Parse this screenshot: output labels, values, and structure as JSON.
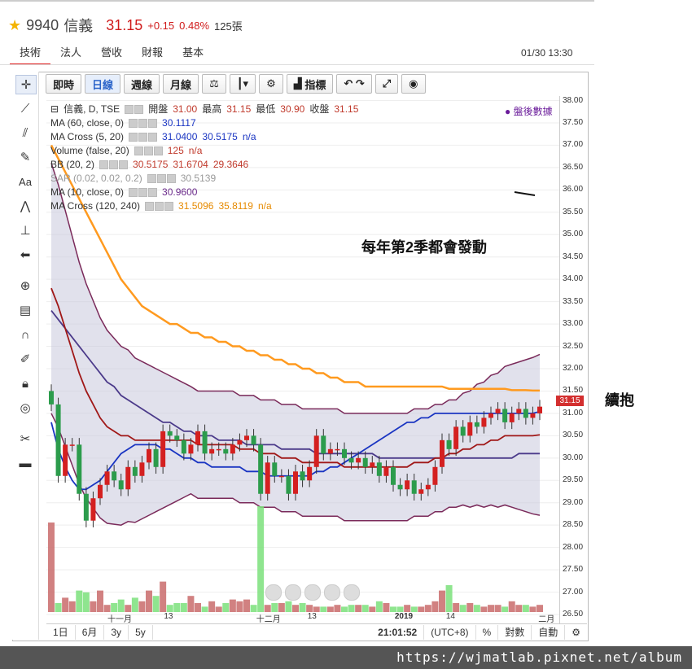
{
  "header": {
    "code": "9940",
    "name": "信義",
    "price": "31.15",
    "change": "+0.15",
    "percent": "0.48%",
    "volume": "125張"
  },
  "nav_tabs": [
    "技術",
    "法人",
    "營收",
    "財報",
    "基本"
  ],
  "datetime": "01/30 13:30",
  "toolbar": {
    "realtime": "即時",
    "daily": "日線",
    "weekly": "週線",
    "monthly": "月線",
    "indicators": "指標"
  },
  "legend": {
    "main": {
      "label": "信義, D, TSE",
      "open_label": "開盤",
      "open": "31.00",
      "high_label": "最高",
      "high": "31.15",
      "low_label": "最低",
      "low": "30.90",
      "close_label": "收盤",
      "close": "31.15"
    },
    "rows": [
      {
        "label": "MA (60, close, 0)",
        "values": [
          "30.1117"
        ],
        "color": "v-blue"
      },
      {
        "label": "MA Cross (5, 20)",
        "values": [
          "31.0400",
          "30.5175",
          "n/a"
        ],
        "color": "v-blue"
      },
      {
        "label": "Volume (false, 20)",
        "values": [
          "125",
          "n/a"
        ],
        "color": "v-red"
      },
      {
        "label": "BB (20, 2)",
        "values": [
          "30.5175",
          "31.6704",
          "29.3646"
        ],
        "color": "v-red"
      },
      {
        "label": "SAR (0.02, 0.02, 0.2)",
        "values": [
          "30.5139"
        ],
        "color": "v-gray"
      },
      {
        "label": "MA (10, close, 0)",
        "values": [
          "30.9600"
        ],
        "color": "v-purple"
      },
      {
        "label": "MA Cross (120, 240)",
        "values": [
          "31.5096",
          "35.8119",
          "n/a"
        ],
        "color": "v-orange"
      }
    ]
  },
  "after_hours": "盤後數據",
  "annotation": "每年第2季都會發動",
  "side_note": "續抱",
  "current_price_label": "31.15",
  "price_axis": [
    "38.00",
    "37.50",
    "37.00",
    "36.50",
    "36.00",
    "35.50",
    "35.00",
    "34.50",
    "34.00",
    "33.50",
    "33.00",
    "32.50",
    "32.00",
    "31.50",
    "31.00",
    "30.50",
    "30.00",
    "29.50",
    "29.00",
    "28.50",
    "28.00",
    "27.50",
    "27.00",
    "26.50"
  ],
  "date_axis": [
    {
      "label": "十一月",
      "pos": 0.135
    },
    {
      "label": "13",
      "pos": 0.245
    },
    {
      "label": "十二月",
      "pos": 0.425
    },
    {
      "label": "13",
      "pos": 0.525
    },
    {
      "label": "2019",
      "pos": 0.695
    },
    {
      "label": "14",
      "pos": 0.795
    },
    {
      "label": "二月",
      "pos": 0.975
    }
  ],
  "bottom_bar": {
    "ranges": [
      "1日",
      "6月",
      "3y",
      "5y"
    ],
    "clock": "21:01:52",
    "tz": "(UTC+8)",
    "pct": "%",
    "log": "對數",
    "auto": "自動"
  },
  "footer_url": "https://wjmatlab.pixnet.net/album",
  "chart_data": {
    "type": "candlestick",
    "ylim": [
      26.3,
      38.1
    ],
    "close": [
      31.2,
      29.6,
      30.3,
      30.3,
      29.2,
      28.6,
      29.1,
      29.4,
      29.7,
      29.5,
      29.3,
      29.8,
      29.6,
      29.9,
      30.2,
      29.8,
      30.6,
      30.5,
      30.4,
      30.1,
      30.3,
      30.6,
      30.1,
      30.2,
      30.2,
      30.1,
      30.3,
      30.4,
      30.5,
      30.3,
      29.2,
      29.9,
      29.6,
      29.6,
      29.2,
      29.7,
      29.5,
      29.8,
      30.5,
      30.1,
      30.2,
      30.2,
      30.0,
      29.9,
      30.0,
      29.8,
      29.9,
      29.6,
      29.8,
      29.4,
      29.3,
      29.5,
      29.2,
      29.3,
      29.4,
      29.8,
      30.4,
      30.2,
      30.7,
      30.5,
      30.8,
      30.7,
      30.9,
      31.0,
      31.1,
      30.8,
      31.0,
      31.1,
      30.9,
      31.0,
      31.15
    ],
    "volume": [
      500,
      50,
      80,
      60,
      120,
      110,
      60,
      120,
      40,
      50,
      70,
      40,
      80,
      60,
      120,
      90,
      170,
      40,
      50,
      50,
      90,
      50,
      30,
      60,
      30,
      50,
      70,
      60,
      70,
      40,
      600,
      40,
      50,
      50,
      60,
      40,
      50,
      40,
      30,
      30,
      30,
      40,
      30,
      40,
      40,
      40,
      30,
      60,
      50,
      30,
      30,
      40,
      30,
      30,
      40,
      60,
      120,
      150,
      50,
      40,
      50,
      40,
      30,
      40,
      40,
      30,
      60,
      40,
      40,
      30,
      40
    ],
    "series": [
      {
        "name": "MA (60, close, 0)",
        "values": [
          33.3,
          33.1,
          32.9,
          32.7,
          32.5,
          32.3,
          32.1,
          31.9,
          31.7,
          31.6,
          31.4,
          31.3,
          31.2,
          31.1,
          31.0,
          30.9,
          30.8,
          30.8,
          30.7,
          30.6,
          30.6,
          30.5,
          30.5,
          30.5,
          30.4,
          30.4,
          30.4,
          30.4,
          30.3,
          30.3,
          30.3,
          30.3,
          30.3,
          30.2,
          30.2,
          30.2,
          30.2,
          30.2,
          30.1,
          30.1,
          30.1,
          30.1,
          30.1,
          30.1,
          30.1,
          30.1,
          30.1,
          30.0,
          30.0,
          30.0,
          30.0,
          30.0,
          30.0,
          30.0,
          30.0,
          30.0,
          30.0,
          30.0,
          30.0,
          30.0,
          30.0,
          30.0,
          30.0,
          30.0,
          30.0,
          30.0,
          30.0,
          30.1,
          30.1,
          30.1,
          30.1
        ]
      },
      {
        "name": "MA Cross (5, 20)",
        "values": [
          30.8,
          30.2,
          29.8,
          29.5,
          29.3,
          29.3,
          29.4,
          29.5,
          29.7,
          29.9,
          30.1,
          30.2,
          30.3,
          30.3,
          30.3,
          30.3,
          30.2,
          30.2,
          30.1,
          30.0,
          30.0,
          29.9,
          29.9,
          29.8,
          29.8,
          29.8,
          29.8,
          29.8,
          29.7,
          29.7,
          29.7,
          29.6,
          29.6,
          29.6,
          29.6,
          29.6,
          29.6,
          29.6,
          29.7,
          29.7,
          29.8,
          29.8,
          29.9,
          30.0,
          30.1,
          30.2,
          30.3,
          30.4,
          30.5,
          30.6,
          30.7,
          30.8,
          30.8,
          30.9,
          30.9,
          31.0,
          31.0,
          31.0,
          31.0,
          31.0,
          31.0,
          31.0,
          31.0,
          31.0,
          31.0,
          31.0,
          31.0,
          31.0,
          31.0,
          31.0,
          31.04
        ]
      },
      {
        "name": "BB (20, 2)",
        "values": [
          33.8,
          33.4,
          32.9,
          32.4,
          31.9,
          31.5,
          31.2,
          30.9,
          30.7,
          30.6,
          30.5,
          30.5,
          30.4,
          30.4,
          30.4,
          30.4,
          30.4,
          30.4,
          30.4,
          30.4,
          30.4,
          30.3,
          30.3,
          30.3,
          30.3,
          30.3,
          30.3,
          30.2,
          30.2,
          30.2,
          30.1,
          30.1,
          30.1,
          30.0,
          30.0,
          30.0,
          29.9,
          29.9,
          29.9,
          29.9,
          29.9,
          29.9,
          29.8,
          29.8,
          29.8,
          29.8,
          29.8,
          29.8,
          29.8,
          29.8,
          29.8,
          29.8,
          29.9,
          29.9,
          29.9,
          30.0,
          30.0,
          30.1,
          30.1,
          30.2,
          30.2,
          30.3,
          30.3,
          30.4,
          30.4,
          30.5,
          30.5,
          30.5,
          30.5,
          30.5,
          30.52
        ]
      },
      {
        "name": "MA Cross (120, 240)",
        "values": [
          37.0,
          36.7,
          36.4,
          36.1,
          35.8,
          35.5,
          35.2,
          34.9,
          34.6,
          34.3,
          34.0,
          33.8,
          33.6,
          33.4,
          33.3,
          33.2,
          33.1,
          33.0,
          33.0,
          32.9,
          32.8,
          32.8,
          32.7,
          32.7,
          32.6,
          32.6,
          32.5,
          32.5,
          32.4,
          32.4,
          32.3,
          32.3,
          32.2,
          32.2,
          32.1,
          32.1,
          32.0,
          32.0,
          31.9,
          31.9,
          31.8,
          31.8,
          31.7,
          31.7,
          31.7,
          31.6,
          31.6,
          31.6,
          31.6,
          31.6,
          31.6,
          31.6,
          31.6,
          31.6,
          31.6,
          31.6,
          31.6,
          31.55,
          31.55,
          31.55,
          31.55,
          31.55,
          31.55,
          31.55,
          31.55,
          31.55,
          31.52,
          31.52,
          31.52,
          31.51,
          31.51
        ]
      }
    ]
  }
}
